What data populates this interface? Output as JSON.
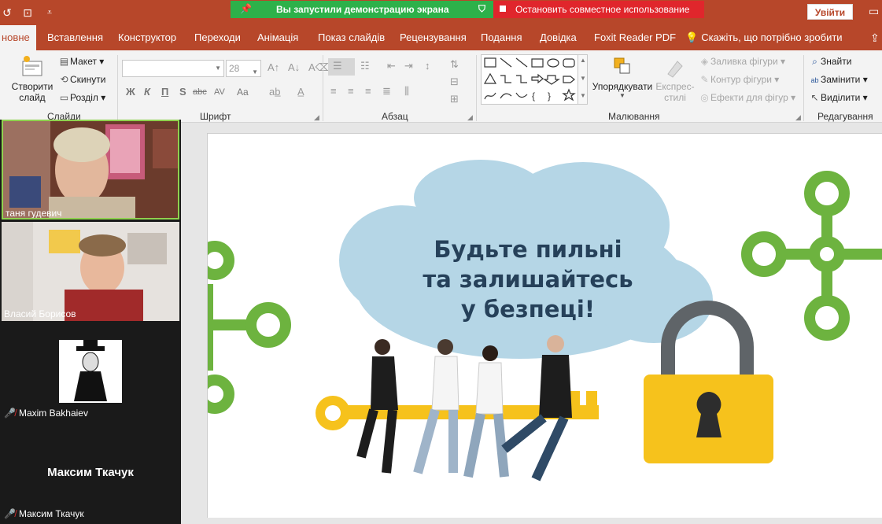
{
  "screen_share": {
    "status_text": "Вы запустили демонстрацию экрана",
    "stop_text": "Остановить совместное использование"
  },
  "account": {
    "login_label": "Увійти"
  },
  "menu": {
    "tabs": [
      "новне",
      "Вставлення",
      "Конструктор",
      "Переходи",
      "Анімація",
      "Показ слайдів",
      "Рецензування",
      "Подання",
      "Довідка",
      "Foxit Reader PDF"
    ],
    "tell_me": "Скажіть, що потрібно зробити"
  },
  "ribbon": {
    "slides": {
      "new_slide_line1": "Створити",
      "new_slide_line2": "слайд",
      "layout": "Макет",
      "reset": "Скинути",
      "section": "Розділ",
      "label": "Слайди"
    },
    "font": {
      "size_value": "28",
      "bold": "Ж",
      "italic": "К",
      "underline": "П",
      "shadow": "S",
      "strike": "abc",
      "spacing": "AV",
      "case": "Aa",
      "label": "Шрифт"
    },
    "paragraph": {
      "label": "Абзац"
    },
    "drawing": {
      "arrange_line1": "Упорядкувати",
      "quick_styles_line1": "Експрес-",
      "quick_styles_line2": "стилі",
      "fill": "Заливка фігури",
      "outline": "Контур фігури",
      "effects": "Ефекти для фігур",
      "label": "Малювання"
    },
    "editing": {
      "find": "Знайти",
      "replace": "Замінити",
      "select": "Виділити",
      "label": "Редагування"
    }
  },
  "participants": [
    {
      "name": "таня гудевич",
      "muted": false
    },
    {
      "name": "Власий Борисов",
      "muted": false
    },
    {
      "name": "Maxim Bakhaiev",
      "muted": true
    },
    {
      "name": "Максим Ткачук",
      "muted": true,
      "display_name": "Максим Ткачук"
    }
  ],
  "slide": {
    "title_line1": "Будьте пильні",
    "title_line2": "та залишайтесь",
    "title_line3": "у безпеці!"
  },
  "colors": {
    "ribbon_brand": "#b7472a",
    "share_green": "#2db14a",
    "share_red": "#e0262c",
    "slide_green": "#6db33f",
    "cloud_blue": "#b5d6e6",
    "lock_yellow": "#f6c21c",
    "title_navy": "#26415a"
  }
}
